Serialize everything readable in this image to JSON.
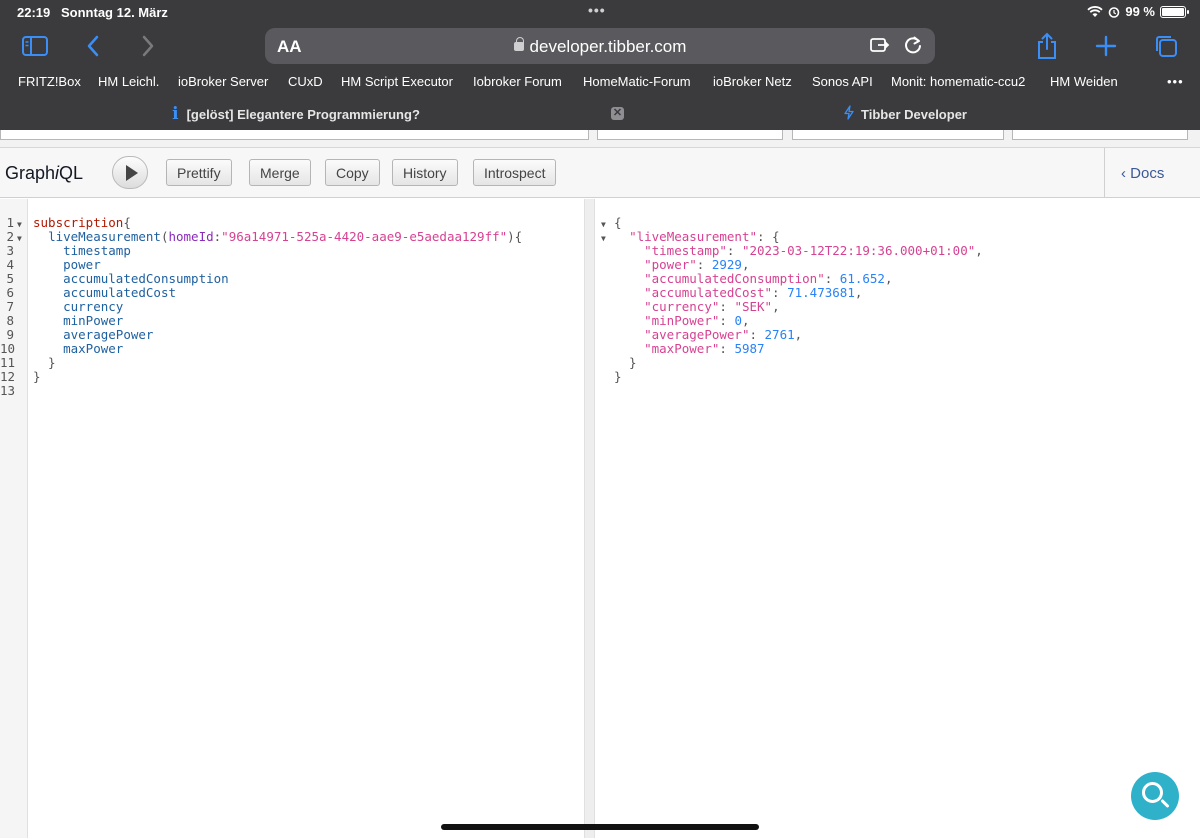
{
  "status_bar": {
    "time": "22:19",
    "date": "Sonntag 12. März",
    "battery": "99 %",
    "battery_level": 0.99
  },
  "toolbar": {
    "text_size_label": "AA",
    "url": "developer.tibber.com"
  },
  "favorites": [
    "FRITZ!Box",
    "HM Leichl.",
    "ioBroker Server",
    "CUxD",
    "HM Script Executor",
    "Iobroker Forum",
    "HomeMatic-Forum",
    "ioBroker Netz",
    "Sonos API",
    "Monit: homematic-ccu2",
    "HM Weiden"
  ],
  "tabs": {
    "active": "[gelöst] Elegantere Programmierung?",
    "second": "Tibber Developer"
  },
  "graphiql": {
    "title_pre": "Graph",
    "title_i": "i",
    "title_post": "QL",
    "buttons": {
      "prettify": "Prettify",
      "merge": "Merge",
      "copy": "Copy",
      "history": "History",
      "introspect": "Introspect"
    },
    "docs": "Docs"
  },
  "query": {
    "line_numbers": [
      "1",
      "2",
      "3",
      "4",
      "5",
      "6",
      "7",
      "8",
      "9",
      "10",
      "11",
      "12",
      "13"
    ],
    "keyword": "subscription",
    "field_root": "liveMeasurement",
    "arg_name": "homeId",
    "arg_value": "\"96a14971-525a-4420-aae9-e5aedaa129ff\"",
    "fields": [
      "timestamp",
      "power",
      "accumulatedConsumption",
      "accumulatedCost",
      "currency",
      "minPower",
      "averagePower",
      "maxPower"
    ]
  },
  "result": {
    "root_key": "\"liveMeasurement\"",
    "timestamp": "\"2023-03-12T22:19:36.000+01:00\"",
    "power": "2929",
    "accumulatedConsumption": "61.652",
    "accumulatedCost": "71.473681",
    "currency": "\"SEK\"",
    "minPower": "0",
    "averagePower": "2761",
    "maxPower": "5987"
  }
}
